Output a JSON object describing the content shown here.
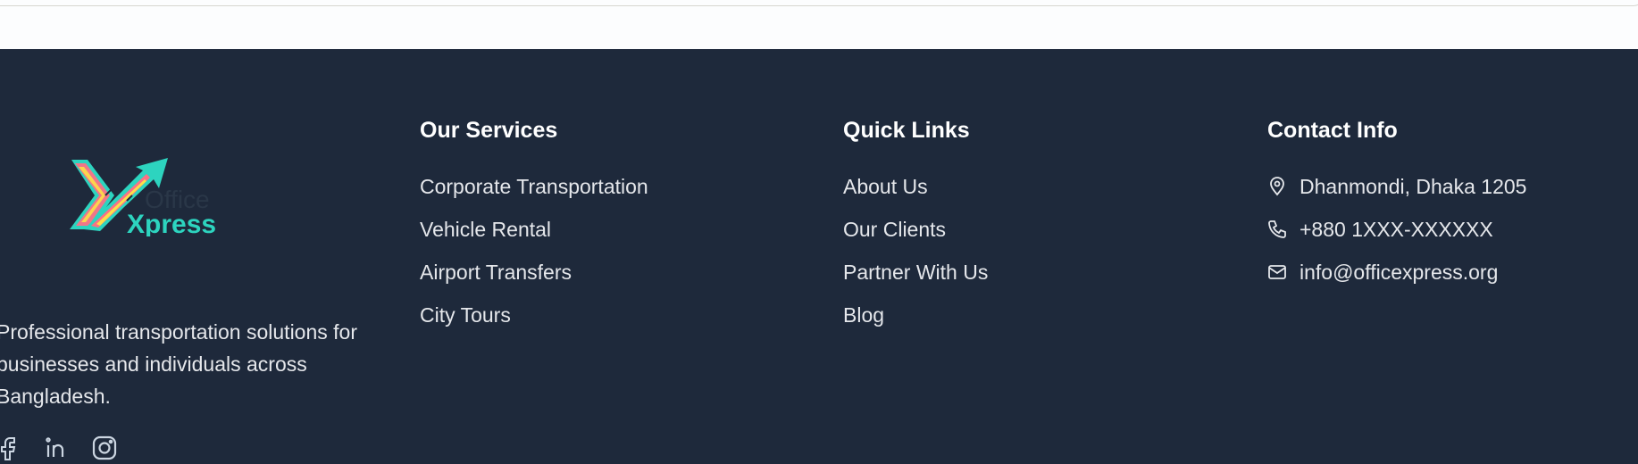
{
  "brand": {
    "logo_word_1": "Office",
    "logo_word_2": "Xpress",
    "tagline": "Professional transportation solutions for businesses and individuals across Bangladesh.",
    "colors": {
      "footer_bg": "#1e293b",
      "logo_teal": "#2dd4bf",
      "logo_yellow": "#fde047",
      "logo_pink": "#fb7185",
      "logo_dark": "#2a3748"
    }
  },
  "social": [
    {
      "icon": "facebook-icon"
    },
    {
      "icon": "linkedin-icon"
    },
    {
      "icon": "instagram-icon"
    }
  ],
  "services": {
    "heading": "Our Services",
    "items": [
      "Corporate Transportation",
      "Vehicle Rental",
      "Airport Transfers",
      "City Tours"
    ]
  },
  "quick_links": {
    "heading": "Quick Links",
    "items": [
      "About Us",
      "Our Clients",
      "Partner With Us",
      "Blog"
    ]
  },
  "contact": {
    "heading": "Contact Info",
    "address": "Dhanmondi, Dhaka 1205",
    "phone": "+880 1XXX-XXXXXX",
    "email": "info@officexpress.org",
    "icons": [
      "map-pin-icon",
      "phone-icon",
      "mail-icon"
    ]
  }
}
